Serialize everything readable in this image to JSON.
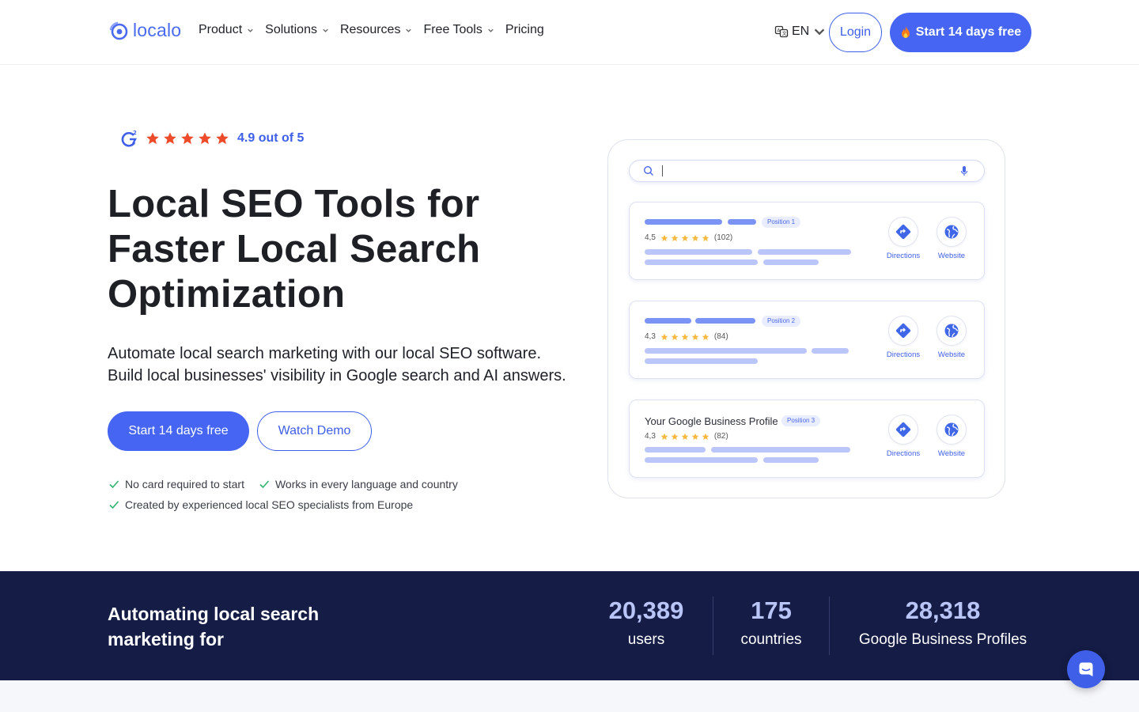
{
  "nav": {
    "logo_text": "localo",
    "menu": [
      {
        "label": "Product",
        "has_dropdown": true
      },
      {
        "label": "Solutions",
        "has_dropdown": true
      },
      {
        "label": "Resources",
        "has_dropdown": true
      },
      {
        "label": "Free Tools",
        "has_dropdown": true
      },
      {
        "label": "Pricing",
        "has_dropdown": false
      }
    ],
    "language": "EN",
    "login_label": "Login",
    "start_label": "Start 14 days free"
  },
  "hero": {
    "rating_text": "4.9 out of 5",
    "rating_stars": 5,
    "title_lines": [
      "Local SEO Tools for",
      "Faster Local Search",
      "Optimization"
    ],
    "subtitle_lines": [
      "Automate local search marketing with our local SEO software.",
      "Build local businesses' visibility in Google search and AI answers."
    ],
    "primary_cta": "Start 14 days free",
    "secondary_cta": "Watch Demo",
    "checks": [
      "No card required to start",
      "Works in every language and country",
      "Created by experienced local SEO specialists from Europe"
    ]
  },
  "mockup": {
    "results": [
      {
        "position_label": "Position 1",
        "rating": "4,5",
        "reviews": "(102)",
        "business_name": "",
        "directions_label": "Directions",
        "website_label": "Website"
      },
      {
        "position_label": "Position 2",
        "rating": "4,3",
        "reviews": "(84)",
        "business_name": "",
        "directions_label": "Directions",
        "website_label": "Website"
      },
      {
        "position_label": "Position 3",
        "rating": "4,3",
        "reviews": "(82)",
        "business_name": "Your Google Business Profile",
        "directions_label": "Directions",
        "website_label": "Website"
      }
    ]
  },
  "stats": {
    "title_lines": [
      "Automating local search",
      "marketing for"
    ],
    "items": [
      {
        "value": "20,389",
        "caption": "users"
      },
      {
        "value": "175",
        "caption": "countries"
      },
      {
        "value": "28,318",
        "caption": "Google Business Profiles"
      }
    ]
  },
  "colors": {
    "brand_blue": "#4565f2",
    "star_red": "#ee4b2b",
    "star_yellow": "#f5b942",
    "check_green": "#2fb36d",
    "band_navy": "#151c45"
  },
  "icons": [
    "logo-icon",
    "chevron-down-icon",
    "translate-icon",
    "fire-icon",
    "g2-icon",
    "star-icon",
    "check-icon",
    "search-icon",
    "microphone-icon",
    "directions-icon",
    "globe-icon",
    "chat-icon"
  ]
}
